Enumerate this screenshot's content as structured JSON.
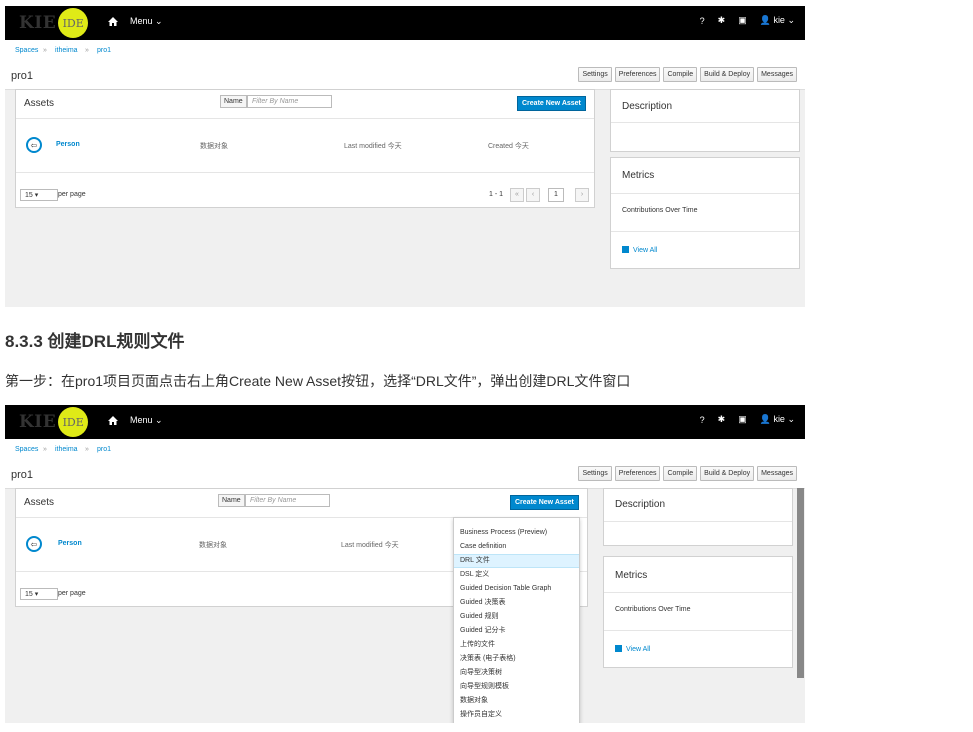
{
  "logo": {
    "kie": "KIE",
    "ide": "IDE"
  },
  "topbar": {
    "menu_label": "Menu",
    "help": "?",
    "user": "kie"
  },
  "breadcrumb": {
    "spaces": "Spaces",
    "org": "itheima",
    "project": "pro1",
    "sep": "»"
  },
  "project_title": "pro1",
  "toolbar": {
    "settings": "Settings",
    "preferences": "Preferences",
    "compile": "Compile",
    "build_deploy": "Build & Deploy",
    "messages": "Messages"
  },
  "assets": {
    "title": "Assets",
    "name_label": "Name",
    "filter_placeholder": "Filter By Name",
    "create_label": "Create New Asset",
    "row": {
      "name": "Person",
      "type": "数据对象",
      "modified": "Last modified 今天",
      "created": "Created 今天"
    },
    "per_page_value": "15",
    "per_page_label": "per page",
    "range": "1 - 1",
    "page": "1"
  },
  "side": {
    "description": "Description",
    "metrics": "Metrics",
    "contributions": "Contributions Over Time",
    "view_all": "View All"
  },
  "heading": "8.3.3 创建DRL规则文件",
  "paragraph": "第一步：在pro1项目页面点击右上角Create New Asset按钮，选择“DRL文件”，弹出创建DRL文件窗口",
  "dropdown_items": [
    "Business Process (Preview)",
    "Case definition",
    "DRL 文件",
    "DSL 定义",
    "Guided Decision Table Graph",
    "Guided 决策表",
    "Guided 规则",
    "Guided 记分卡",
    "上传的文件",
    "决策表 (电子表格)",
    "向导型决策树",
    "向导型规则模板",
    "数据对象",
    "操作员自定义"
  ],
  "colors": {
    "accent": "#0088ce",
    "topbar": "#000000",
    "logo_circle": "#dfea17"
  }
}
